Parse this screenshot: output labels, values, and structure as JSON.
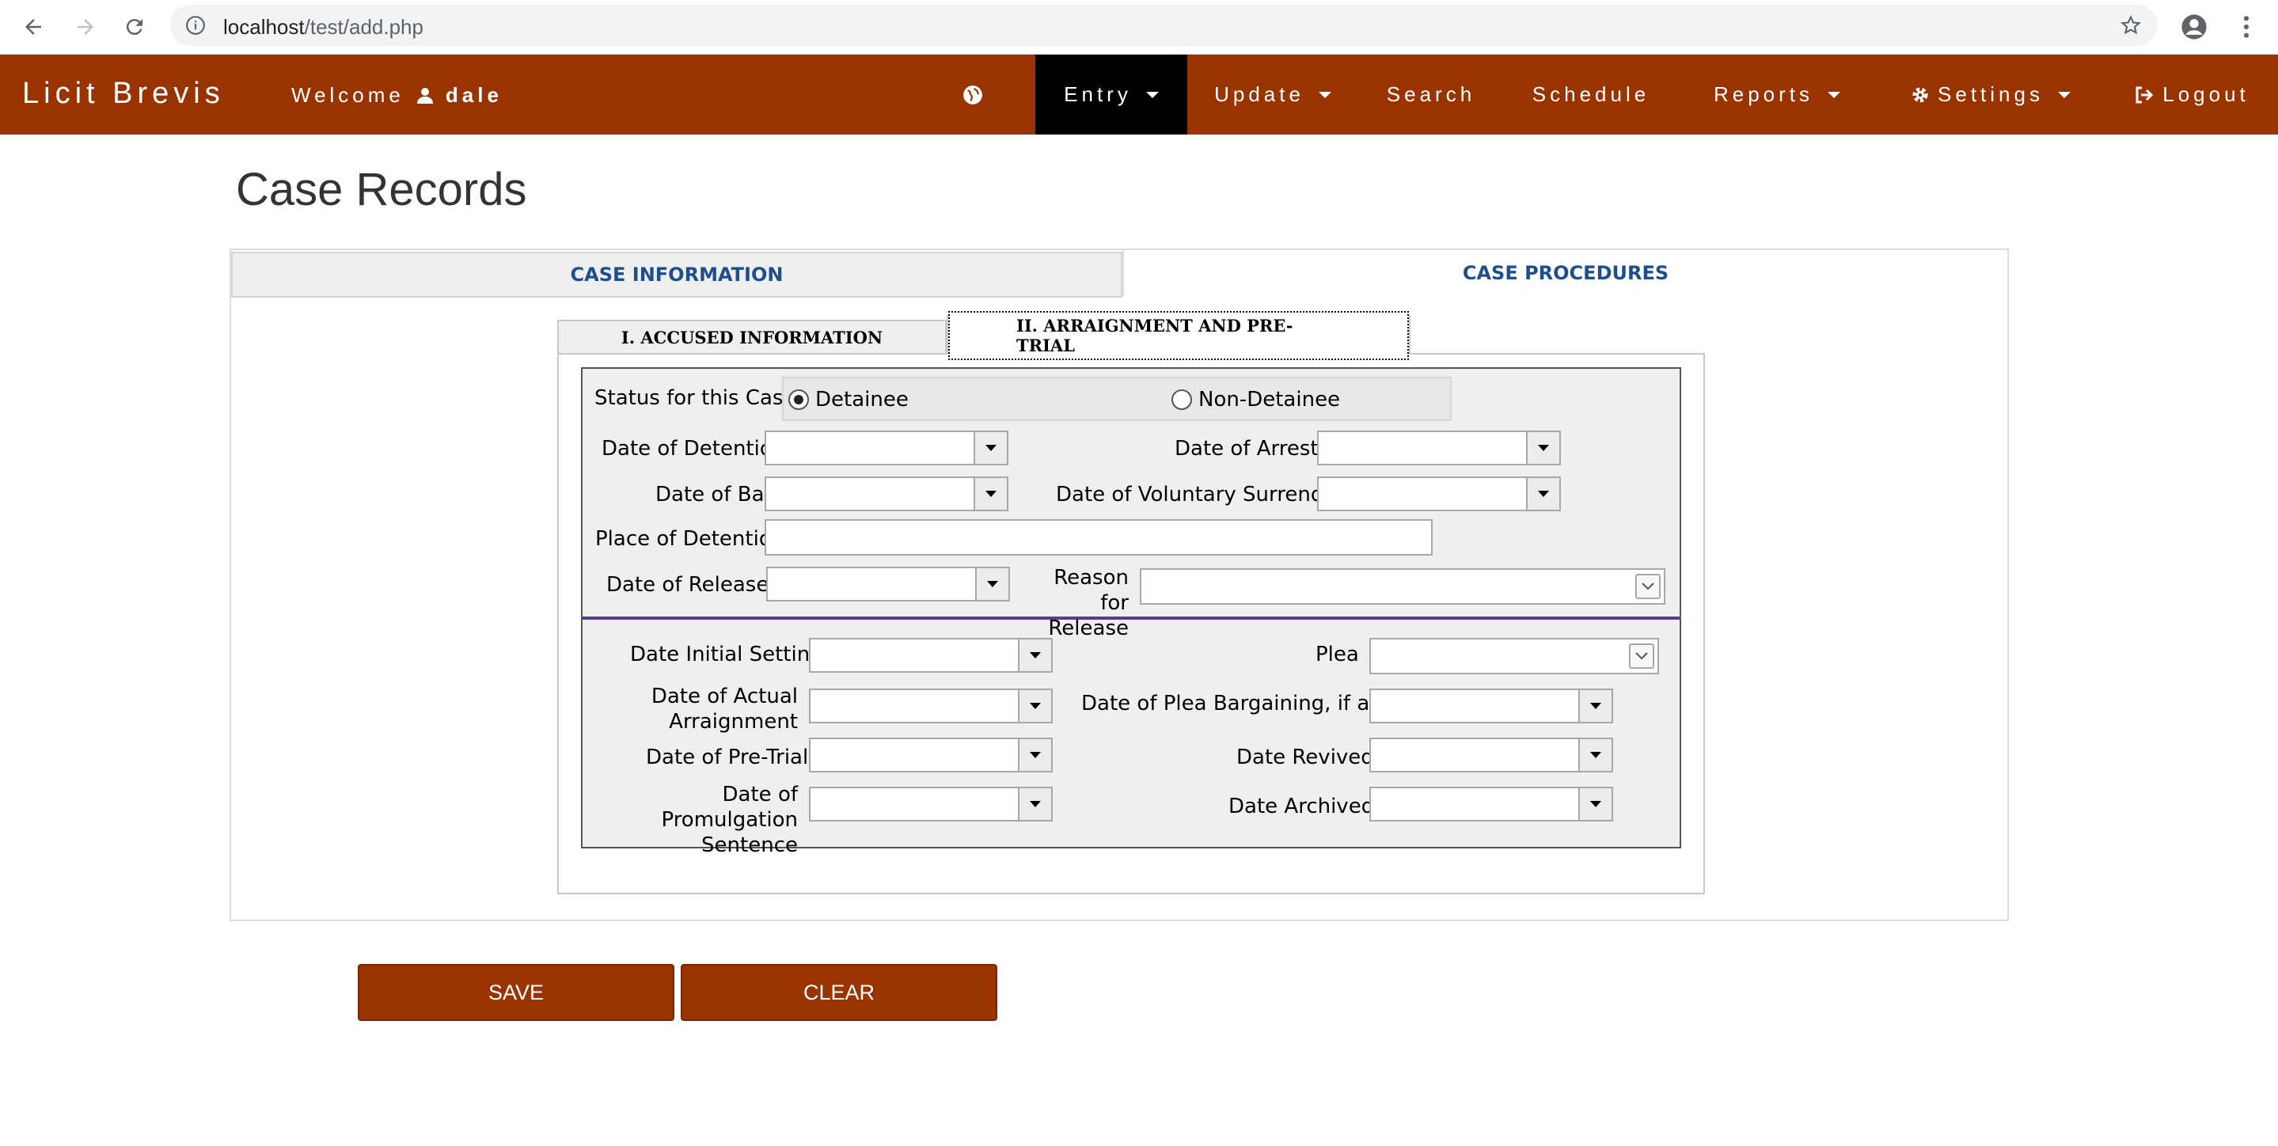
{
  "browser": {
    "url_host": "localhost",
    "url_path": "/test/add.php"
  },
  "navbar": {
    "brand": "Licit Brevis",
    "welcome_text": "Welcome",
    "username": "dale",
    "items": [
      {
        "label": "Entry",
        "dropdown": true,
        "active": true
      },
      {
        "label": "Update",
        "dropdown": true
      },
      {
        "label": "Search"
      },
      {
        "label": "Schedule"
      },
      {
        "label": "Reports",
        "dropdown": true
      },
      {
        "label": "Settings",
        "dropdown": true,
        "icon": "gear-icon"
      },
      {
        "label": "Logout",
        "icon": "logout-icon"
      }
    ],
    "colors": {
      "bar": "#993300",
      "active": "#000000"
    }
  },
  "page": {
    "title": "Case Records"
  },
  "outer_tabs": [
    "CASE INFORMATION",
    "CASE PROCEDURES"
  ],
  "inner_tabs": [
    "I. ACCUSED INFORMATION",
    "II. ARRAIGNMENT AND PRE-TRIAL"
  ],
  "form": {
    "status_label": "Status for this Case",
    "status_options": [
      "Detainee",
      "Non-Detainee"
    ],
    "status_selected": "Detainee",
    "date_of_detention": "Date of Detention",
    "date_of_arrest": "Date of Arrest",
    "date_of_bail": "Date of Bail",
    "date_of_voluntary_surrender": "Date of Voluntary Surrender",
    "place_of_detention": "Place of Detention",
    "date_of_released": "Date of Released",
    "reason_for_release_1": "Reason for",
    "reason_for_release_2": "Release",
    "date_initial_setting": "Date Initial Setting",
    "plea": "Plea",
    "date_actual_arraignment_1": "Date of Actual",
    "date_actual_arraignment_2": "Arraignment",
    "date_plea_bargaining": "Date of Plea Bargaining, if any",
    "date_pre_trial": "Date of Pre-Trial",
    "date_revived": "Date Revived",
    "date_promulgation_1": "Date of Promulgation",
    "date_promulgation_2": "Sentence",
    "date_archived": "Date Archived"
  },
  "buttons": {
    "save": "SAVE",
    "clear": "CLEAR"
  }
}
